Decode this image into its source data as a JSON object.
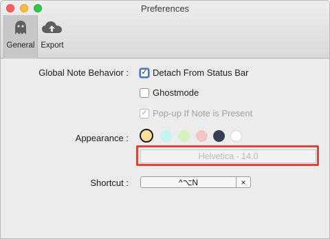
{
  "window": {
    "title": "Preferences"
  },
  "tabs": [
    {
      "label": "General",
      "icon": "ghost-icon",
      "selected": true
    },
    {
      "label": "Export",
      "icon": "cloud-upload-icon",
      "selected": false
    }
  ],
  "labels": {
    "global_note_behavior": "Global Note Behavior :",
    "appearance": "Appearance :",
    "shortcut": "Shortcut :"
  },
  "options": {
    "detach": {
      "label": "Detach From Status Bar",
      "checked": true
    },
    "ghostmode": {
      "label": "Ghostmode",
      "checked": false
    },
    "popup": {
      "label": "Pop-up If Note is Present",
      "checked": true,
      "disabled": true
    }
  },
  "appearance": {
    "swatches": [
      {
        "name": "yellow",
        "color": "#fbdc9c",
        "selected": true
      },
      {
        "name": "cyan",
        "color": "#c6f3f3",
        "selected": false
      },
      {
        "name": "green",
        "color": "#d8f2be",
        "selected": false
      },
      {
        "name": "pink",
        "color": "#f3c6c6",
        "selected": false
      },
      {
        "name": "navy",
        "color": "#363f57",
        "selected": false
      },
      {
        "name": "white",
        "color": "#ffffff",
        "selected": false
      }
    ],
    "font": "Helvetica - 14.0"
  },
  "shortcut": {
    "keys": "^⌥N",
    "clear": "×"
  }
}
